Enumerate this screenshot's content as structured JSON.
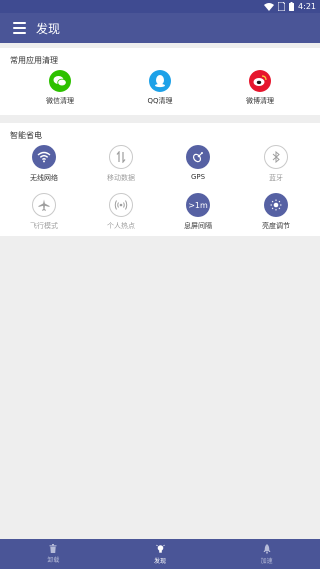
{
  "status": {
    "time": "4:21"
  },
  "app_bar": {
    "title": "发现"
  },
  "common_clean": {
    "title": "常用应用清理",
    "items": [
      {
        "label": "微信清理",
        "icon": "wechat-icon",
        "color": "#2dc100"
      },
      {
        "label": "QQ清理",
        "icon": "qq-icon",
        "color": "#1da1e8"
      },
      {
        "label": "微博清理",
        "icon": "weibo-icon",
        "color": "#e6162d"
      }
    ]
  },
  "power_saving": {
    "title": "智能省电",
    "items": [
      {
        "label": "无线网络",
        "icon": "wifi-icon",
        "state": "on"
      },
      {
        "label": "移动数据",
        "icon": "mobile-data-icon",
        "state": "off"
      },
      {
        "label": "GPS",
        "icon": "gps-icon",
        "state": "on"
      },
      {
        "label": "蓝牙",
        "icon": "bluetooth-icon",
        "state": "off"
      },
      {
        "label": "飞行模式",
        "icon": "airplane-icon",
        "state": "off"
      },
      {
        "label": "个人热点",
        "icon": "hotspot-icon",
        "state": "off"
      },
      {
        "label": "息屏间隔",
        "icon": "screen-timeout-icon",
        "state": "on",
        "value": ">1m"
      },
      {
        "label": "亮度调节",
        "icon": "brightness-icon",
        "state": "on"
      }
    ]
  },
  "bottom_nav": [
    {
      "label": "卸载",
      "icon": "trash-icon",
      "active": false
    },
    {
      "label": "发现",
      "icon": "lightbulb-icon",
      "active": true
    },
    {
      "label": "加速",
      "icon": "rocket-icon",
      "active": false
    }
  ],
  "colors": {
    "primary": "#4a5597",
    "toggle_on": "#5661a3",
    "background": "#eeeeee"
  }
}
